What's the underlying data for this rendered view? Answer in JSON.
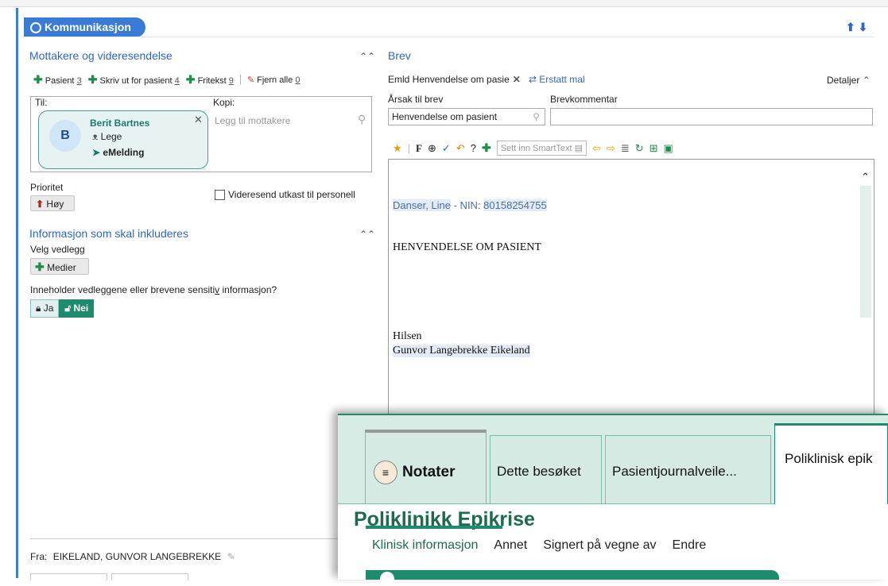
{
  "window": {
    "title": "Kommunikasjon",
    "nav_arrows": "⬆ ⬇"
  },
  "recipients": {
    "section_title": "Mottakere og videresendelse",
    "actions": [
      {
        "label": "Pasient",
        "count": "3"
      },
      {
        "label": "Skriv ut for pasient",
        "count": "4"
      },
      {
        "label": "Fritekst",
        "count": "9"
      },
      {
        "label": "Fjern alle",
        "count": "0"
      }
    ],
    "to_label": "Til:",
    "copy_label": "Kopi:",
    "copy_placeholder": "Legg til mottakere",
    "card": {
      "initial": "B",
      "name": "Berit Bartnes",
      "role": "Lege",
      "channel": "eMelding"
    }
  },
  "priority": {
    "label": "Prioritet",
    "value": "Høy",
    "forward_checkbox_label": "Videresend utkast til personell"
  },
  "info": {
    "section_title": "Informasjon som skal inkluderes",
    "attach_label": "Velg vedlegg",
    "media_button": "Medier",
    "sensitive_question_pre": "Inneholder vedleggene eller brevene sensiti",
    "sensitive_question_u": "v",
    "sensitive_question_post": " informasjon?",
    "yes_label": "Ja",
    "no_label": "Nei"
  },
  "from": {
    "label": "Fra:",
    "value": "EIKELAND, GUNVOR LANGEBREKKE"
  },
  "letter": {
    "section_title": "Brev",
    "template_name": "Emld Henvendelse om pasie",
    "replace_label": "Erstatt mal",
    "details_label": "Detaljer",
    "reason_label": "Årsak til brev",
    "reason_value": "Henvendelse om pasient",
    "comment_label": "Brevkommentar",
    "comment_value": "",
    "smarttext_placeholder": "Sett inn SmartText",
    "body": {
      "patient_name": "Danser, Line",
      "nin_text": " - NIN: ",
      "nin": "80158254755",
      "heading": "HENVENDELSE OM PASIENT",
      "greeting": "Hilsen",
      "signature": "Gunvor Langebrekke Eikeland"
    }
  },
  "overlay": {
    "tabs": [
      "Notater",
      "Dette besøket",
      "Pasientjournalveile...",
      "Poliklinisk epik"
    ],
    "heading": "Poliklinikk Epikrise",
    "links": [
      "Klinisk informasjon",
      "Annet",
      "Signert på vegne av",
      "Endre"
    ]
  },
  "colors": {
    "accent_blue": "#3a7bd5",
    "accent_green": "#1e8a6e",
    "priority_red": "#b3261e"
  }
}
